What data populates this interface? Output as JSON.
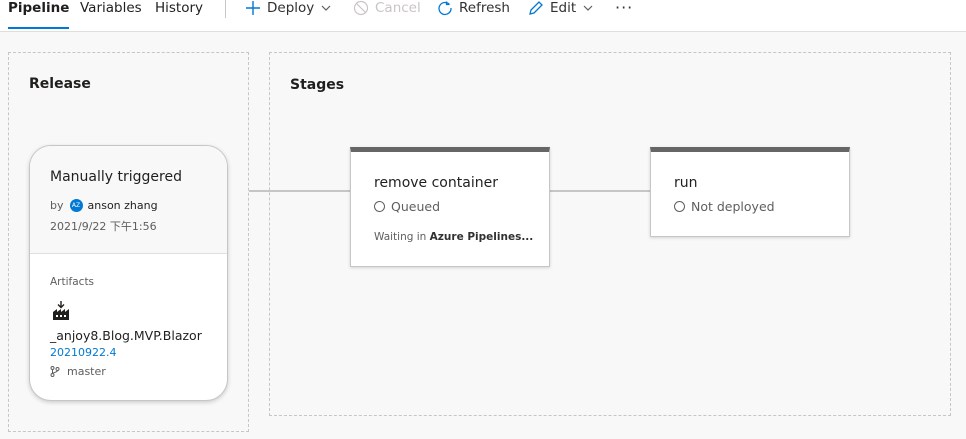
{
  "tabs": [
    {
      "label": "Pipeline",
      "active": true
    },
    {
      "label": "Variables",
      "active": false
    },
    {
      "label": "History",
      "active": false
    }
  ],
  "toolbar": {
    "deploy_label": "Deploy",
    "cancel_label": "Cancel",
    "refresh_label": "Refresh",
    "edit_label": "Edit",
    "more_label": "···"
  },
  "release": {
    "title": "Release",
    "trigger": "Manually triggered",
    "by_label": "by",
    "avatar_initials": "AZ",
    "user": "anson zhang",
    "date": "2021/9/22 下午1:56",
    "artifacts_label": "Artifacts",
    "artifact_name": "_anjoy8.Blog.MVP.Blazor",
    "artifact_version": "20210922.4",
    "branch": "master"
  },
  "stages_title": "Stages",
  "stages": [
    {
      "name": "remove container",
      "status": "Queued",
      "message_prefix": "Waiting in",
      "message_bold": "Azure Pipelines..."
    },
    {
      "name": "run",
      "status": "Not deployed"
    }
  ],
  "colors": {
    "accent": "#0078d4",
    "stage_header": "#666666",
    "connector": "#c8c6c4"
  }
}
